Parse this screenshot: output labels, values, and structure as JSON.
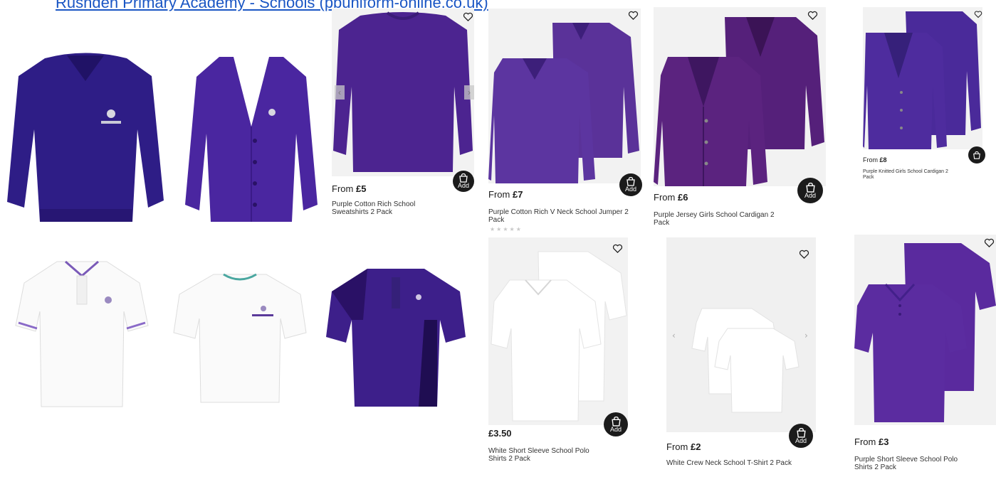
{
  "header": {
    "link_text": "Rushden Primary Academy - Schools (pbuniform-online.co.uk)"
  },
  "colors": {
    "purple": "#4a2694",
    "deep_purple": "#3d1f7a",
    "link": "#1a56c4"
  },
  "products": [
    {
      "price_prefix": "From",
      "price": "£5",
      "name": "Purple Cotton Rich School Sweatshirts 2 Pack",
      "add_label": "Add"
    },
    {
      "price_prefix": "From",
      "price": "£7",
      "name": "Purple Cotton Rich V Neck School Jumper 2 Pack",
      "add_label": "Add"
    },
    {
      "price_prefix": "From",
      "price": "£6",
      "name": "Purple Jersey Girls School Cardigan 2 Pack",
      "add_label": "Add"
    },
    {
      "price_prefix": "From",
      "price": "£8",
      "name": "Purple Knitted Girls School Cardigan 2 Pack"
    },
    {
      "price_prefix": "",
      "price": "£3.50",
      "name": "White Short Sleeve School Polo Shirts 2 Pack",
      "add_label": "Add"
    },
    {
      "price_prefix": "From",
      "price": "£2",
      "name": "White Crew Neck School T-Shirt 2 Pack",
      "add_label": "Add"
    },
    {
      "price_prefix": "From",
      "price": "£3",
      "name": "Purple Short Sleeve School Polo Shirts 2 Pack"
    }
  ],
  "icons": {
    "wishlist": "heart-outline-icon",
    "basket": "shopping-basket-icon",
    "prev": "chevron-left-icon",
    "next": "chevron-right-icon"
  }
}
